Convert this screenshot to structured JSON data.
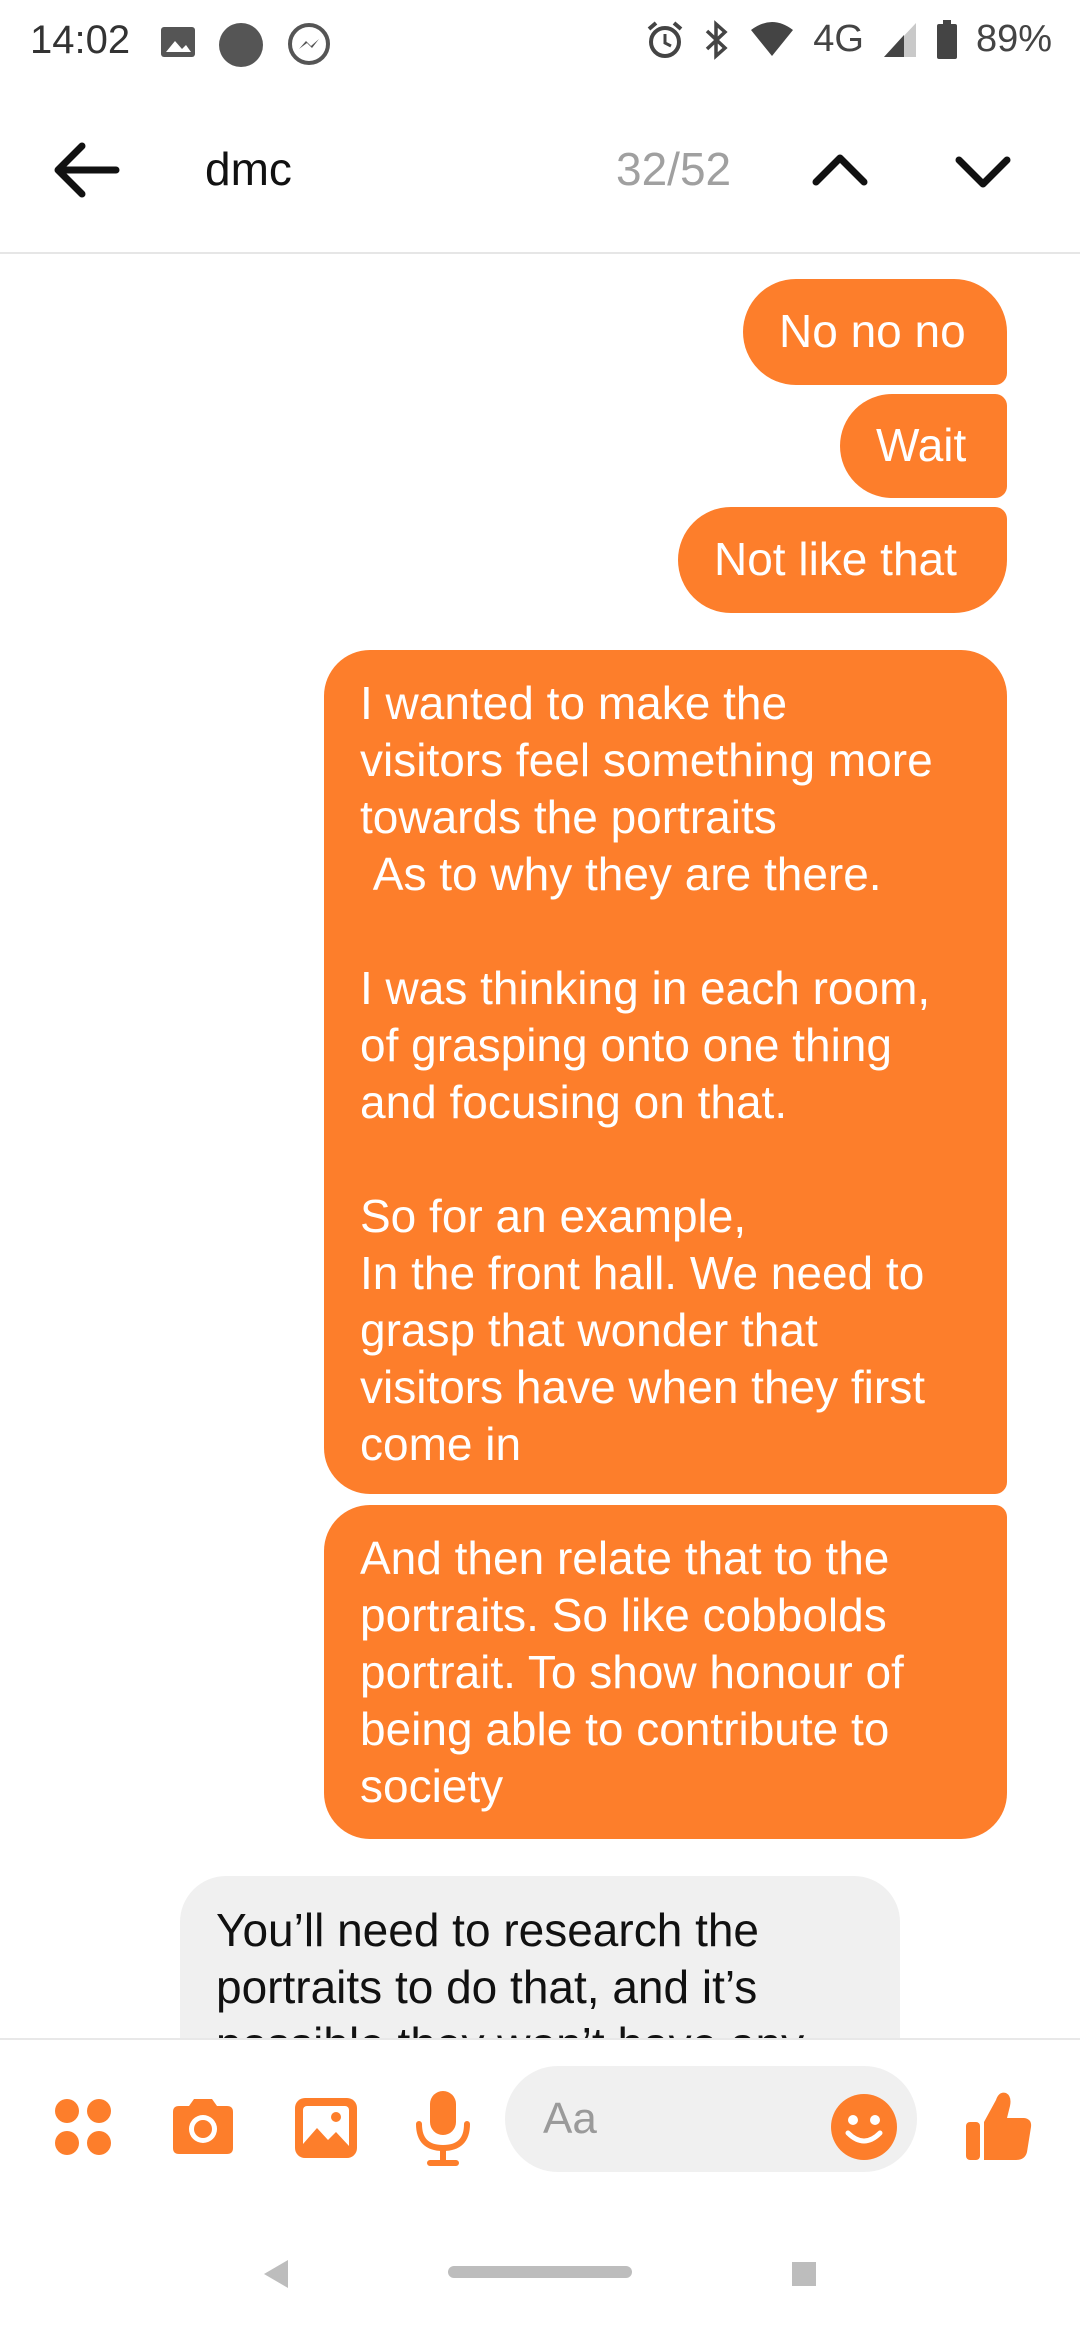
{
  "status_bar": {
    "time": "14:02",
    "network": "4G",
    "battery": "89%",
    "icons": [
      "image-icon",
      "circle-notification-icon",
      "messenger-icon",
      "alarm-icon",
      "bluetooth-icon",
      "wifi-icon",
      "signal-icon",
      "battery-icon"
    ]
  },
  "header": {
    "search_term": "dmc",
    "match_counter": "32/52",
    "icons": [
      "back-arrow-icon",
      "chevron-up-icon",
      "chevron-down-icon"
    ]
  },
  "messages": [
    {
      "direction": "outgoing",
      "text": "No no no"
    },
    {
      "direction": "outgoing",
      "text": "Wait"
    },
    {
      "direction": "outgoing",
      "text": "Not like that"
    },
    {
      "direction": "outgoing",
      "text": "I wanted to make the\nvisitors feel something more\ntowards the portraits\n As to why they are there.\n\nI was thinking in each room,\nof grasping onto one thing\nand focusing on that.\n\nSo for an example,\nIn the front hall. We need to\ngrasp that wonder that\nvisitors have when they first\ncome in"
    },
    {
      "direction": "outgoing",
      "text": "And then relate that to the\nportraits. So like cobbolds\nportrait. To show honour of\nbeing able to contribute to\nsociety"
    },
    {
      "direction": "incoming",
      "text": "You’ll need to research the\nportraits to do that, and it’s\npossible they won’t have any"
    }
  ],
  "composer": {
    "placeholder": "Aa",
    "icons": [
      "more-apps-icon",
      "camera-icon",
      "gallery-icon",
      "microphone-icon",
      "emoji-icon",
      "thumbs-up-icon"
    ]
  },
  "navbar": {
    "icons": [
      "nav-back-icon",
      "home-pill-icon",
      "recents-icon"
    ]
  },
  "colors": {
    "accent": "#fd7e2b",
    "incoming_bubble": "#f0f0f0",
    "muted_text": "#a0a0a0"
  }
}
